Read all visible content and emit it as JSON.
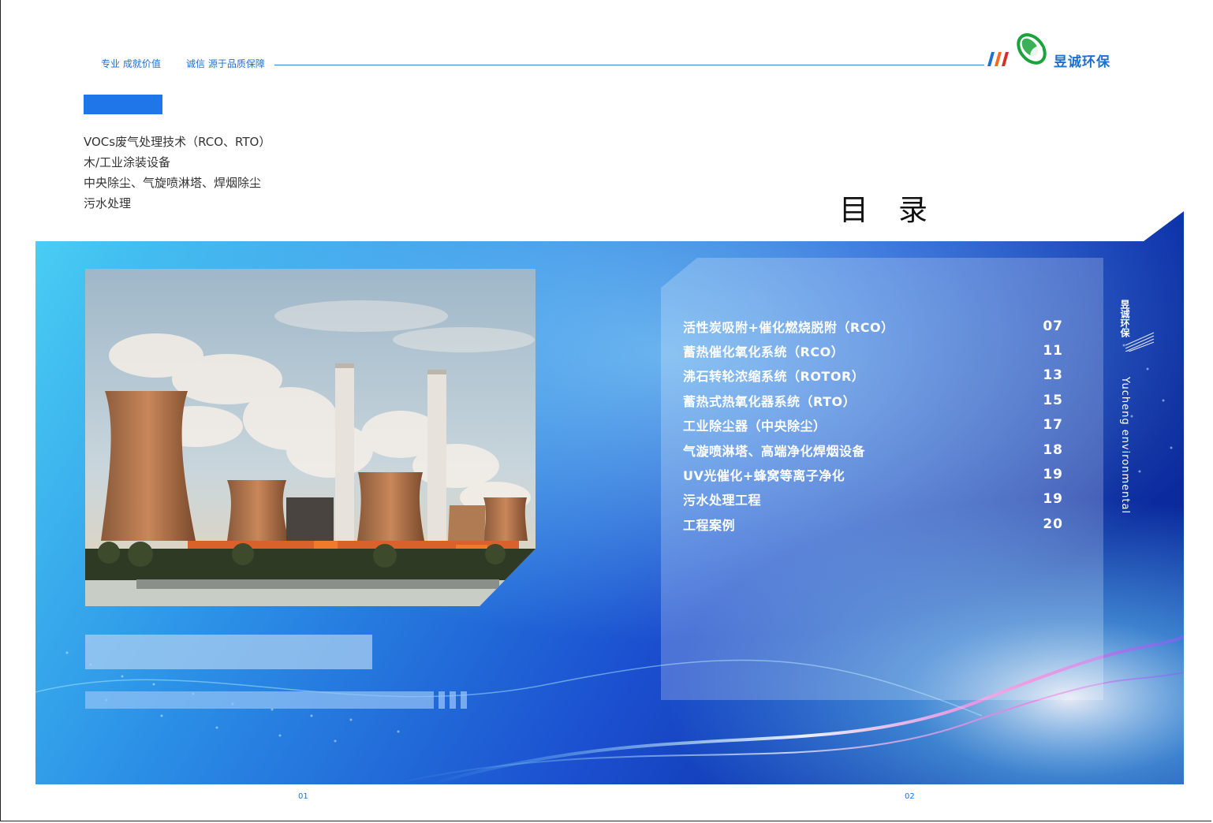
{
  "header": {
    "slogan_left": "专业  成就价值",
    "slogan_right": "诚信  源于品质保障",
    "brand": "昱诚环保"
  },
  "services": [
    "VOCs废气处理技术（RCO、RTO）",
    "木/工业涂装设备",
    "中央除尘、气旋喷淋塔、焊烟除尘",
    "污水处理"
  ],
  "toc": {
    "title": "目录",
    "items": [
      {
        "label": "活性炭吸附+催化燃烧脱附（RCO）",
        "page": "07"
      },
      {
        "label": "蓄热催化氧化系统（RCO）",
        "page": "11"
      },
      {
        "label": "沸石转轮浓缩系统（ROTOR）",
        "page": "13"
      },
      {
        "label": "蓄热式热氧化器系统（RTO）",
        "page": "15"
      },
      {
        "label": "工业除尘器（中央除尘）",
        "page": "17"
      },
      {
        "label": "气漩喷淋塔、高端净化焊烟设备",
        "page": "18"
      },
      {
        "label": "UV光催化+蜂窝等离子净化",
        "page": "19"
      },
      {
        "label": "污水处理工程",
        "page": "19"
      },
      {
        "label": "工程案例",
        "page": "20"
      }
    ]
  },
  "side_label": {
    "brand": "昱诚环保",
    "english": "Yucheng environmental"
  },
  "page_numbers": {
    "left": "01",
    "right": "02"
  },
  "colors": {
    "accent_blue": "#1e76e8",
    "banner_deep": "#0b2fa8",
    "banner_light": "#3fc3f2",
    "stripe_blue": "#1f6fd1",
    "stripe_orange": "#f26a21",
    "stripe_red": "#d92b2b",
    "logo_green": "#19a33a"
  }
}
